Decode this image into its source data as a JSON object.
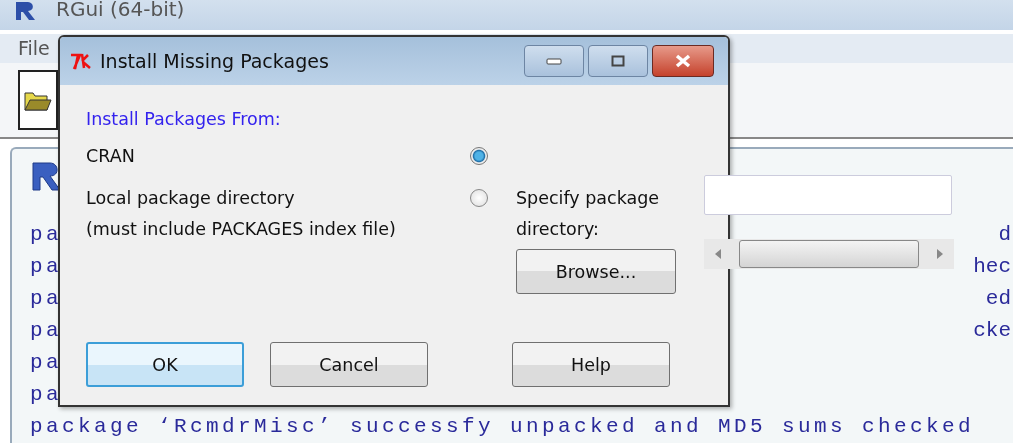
{
  "background_window": {
    "title": "RGui (64-bit)",
    "menu": [
      "File"
    ],
    "console_rows": [
      {
        "left": "pa",
        "right": "d"
      },
      {
        "left": "pa",
        "right": "hec"
      },
      {
        "left": "pa",
        "right": "ed"
      },
      {
        "left": "pa",
        "right": "cke"
      },
      {
        "left": "pa",
        "right": ""
      },
      {
        "left": "pa",
        "right": ""
      }
    ],
    "console_last_line": "package ‘RcmdrMisc’ successfy unpacked and MD5 sums checked"
  },
  "dialog": {
    "title": "Install Missing Packages",
    "section_label": "Install Packages From:",
    "sources": [
      {
        "label": "CRAN",
        "selected": true
      },
      {
        "label": "Local package directory\n(must include PACKAGES index file)",
        "selected": false
      }
    ],
    "directory_label": "Specify package directory:",
    "browse_button": "Browse...",
    "buttons": [
      {
        "label": "OK",
        "focused": true
      },
      {
        "label": "Cancel",
        "focused": false
      },
      {
        "label": "Help",
        "focused": false
      }
    ]
  }
}
